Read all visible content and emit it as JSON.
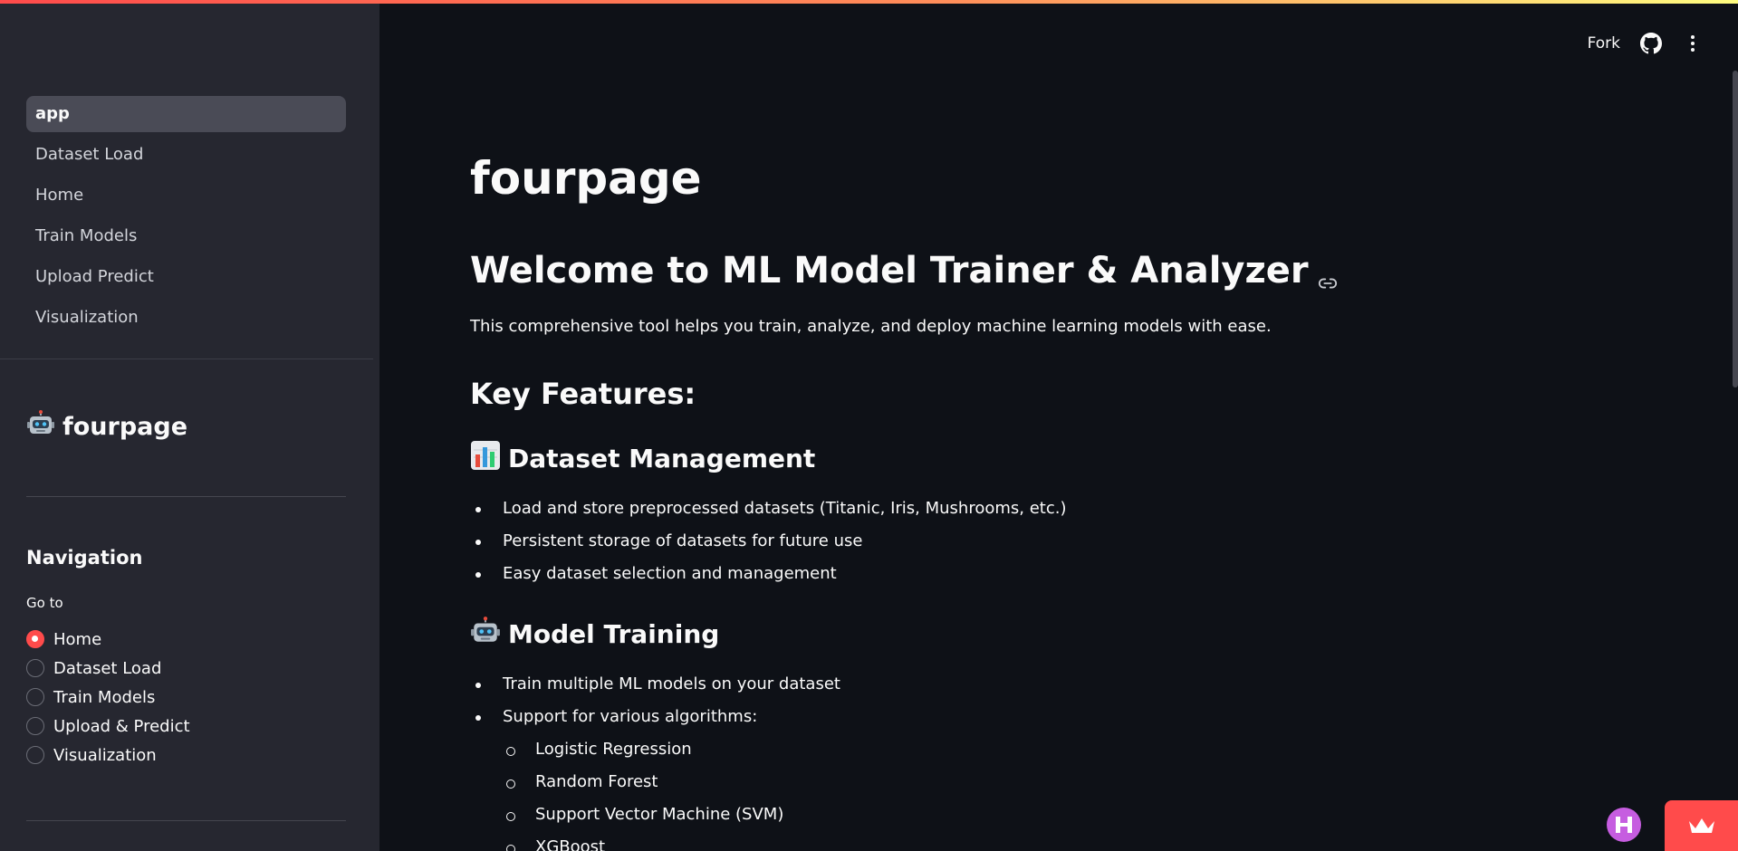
{
  "header": {
    "fork_label": "Fork",
    "github_icon": "github-icon",
    "menu_icon": "kebab-menu-icon"
  },
  "sidebar": {
    "pages": [
      {
        "label": "app",
        "active": true
      },
      {
        "label": "Dataset Load",
        "active": false
      },
      {
        "label": "Home",
        "active": false
      },
      {
        "label": "Train Models",
        "active": false
      },
      {
        "label": "Upload Predict",
        "active": false
      },
      {
        "label": "Visualization",
        "active": false
      }
    ],
    "title": "fourpage",
    "title_icon": "robot-icon",
    "nav_heading": "Navigation",
    "radio_label": "Go to",
    "radio_options": [
      {
        "label": "Home",
        "checked": true
      },
      {
        "label": "Dataset Load",
        "checked": false
      },
      {
        "label": "Train Models",
        "checked": false
      },
      {
        "label": "Upload & Predict",
        "checked": false
      },
      {
        "label": "Visualization",
        "checked": false
      }
    ]
  },
  "main": {
    "title": "fourpage",
    "welcome": "Welcome to ML Model Trainer & Analyzer",
    "intro": "This comprehensive tool helps you train, analyze, and deploy machine learning models with ease.",
    "key_features": "Key Features:",
    "dataset_section": {
      "icon": "bar-chart-icon",
      "title": "Dataset Management",
      "items": [
        "Load and store preprocessed datasets (Titanic, Iris, Mushrooms, etc.)",
        "Persistent storage of datasets for future use",
        "Easy dataset selection and management"
      ]
    },
    "training_section": {
      "icon": "robot-icon",
      "title": "Model Training",
      "items": [
        "Train multiple ML models on your dataset",
        "Support for various algorithms:"
      ],
      "sub_items": [
        "Logistic Regression",
        "Random Forest",
        "Support Vector Machine (SVM)",
        "XGBoost"
      ]
    }
  },
  "colors": {
    "accent": "#ff4b4b",
    "sidebar_bg": "#262730",
    "main_bg": "#0e1117"
  }
}
